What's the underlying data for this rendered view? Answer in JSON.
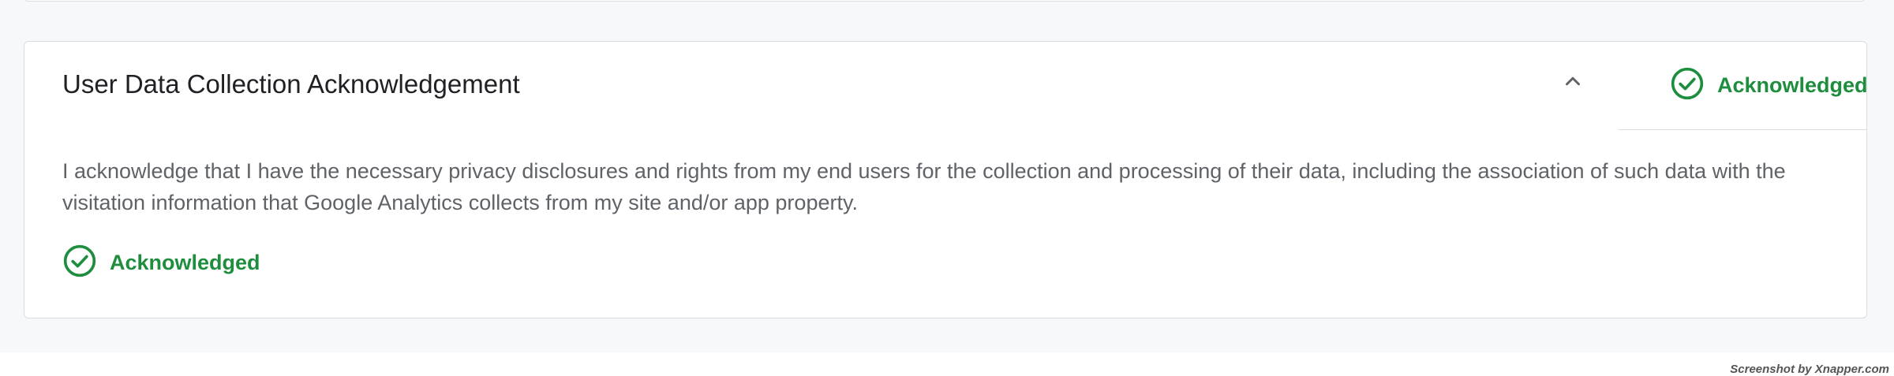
{
  "card": {
    "title": "User Data Collection Acknowledgement",
    "status_label": "Acknowledged",
    "body_text": "I acknowledge that I have the necessary privacy disclosures and rights from my end users for the collection and processing of their data, including the association of such data with the visitation information that Google Analytics collects from my site and/or app property.",
    "footer_status_label": "Acknowledged",
    "collapse_icon": "chevron-up-icon",
    "status_icon": "check-circle-icon",
    "status_color": "#1e8e3e"
  },
  "watermark": "Screenshot by Xnapper.com"
}
